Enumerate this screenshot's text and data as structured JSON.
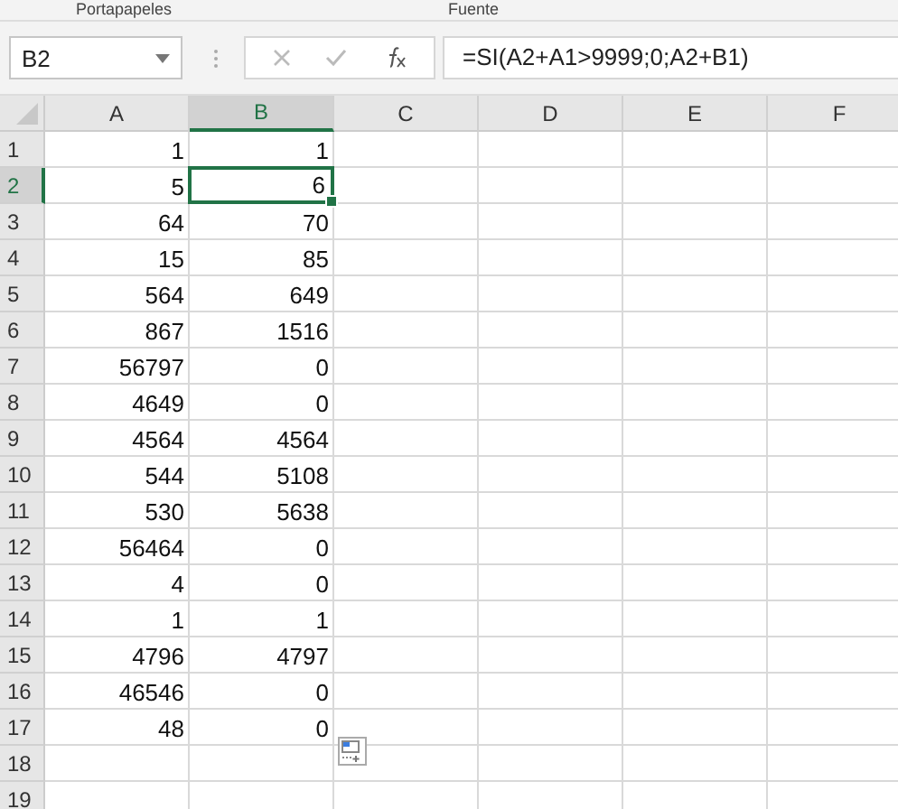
{
  "ribbon_groups": [
    "Portapapeles",
    "Fuente"
  ],
  "name_box": {
    "value": "B2"
  },
  "formula_bar": {
    "value": "=SI(A2+A1>9999;0;A2+B1)"
  },
  "columns": [
    {
      "label": "A",
      "selected": false
    },
    {
      "label": "B",
      "selected": true
    },
    {
      "label": "C",
      "selected": false
    },
    {
      "label": "D",
      "selected": false
    },
    {
      "label": "E",
      "selected": false
    },
    {
      "label": "F",
      "selected": false
    }
  ],
  "rows": [
    {
      "number": "1",
      "selected": false,
      "cells": [
        "1",
        "1"
      ]
    },
    {
      "number": "2",
      "selected": true,
      "cells": [
        "5",
        "6"
      ]
    },
    {
      "number": "3",
      "selected": false,
      "cells": [
        "64",
        "70"
      ]
    },
    {
      "number": "4",
      "selected": false,
      "cells": [
        "15",
        "85"
      ]
    },
    {
      "number": "5",
      "selected": false,
      "cells": [
        "564",
        "649"
      ]
    },
    {
      "number": "6",
      "selected": false,
      "cells": [
        "867",
        "1516"
      ]
    },
    {
      "number": "7",
      "selected": false,
      "cells": [
        "56797",
        "0"
      ]
    },
    {
      "number": "8",
      "selected": false,
      "cells": [
        "4649",
        "0"
      ]
    },
    {
      "number": "9",
      "selected": false,
      "cells": [
        "4564",
        "4564"
      ]
    },
    {
      "number": "10",
      "selected": false,
      "cells": [
        "544",
        "5108"
      ]
    },
    {
      "number": "11",
      "selected": false,
      "cells": [
        "530",
        "5638"
      ]
    },
    {
      "number": "12",
      "selected": false,
      "cells": [
        "56464",
        "0"
      ]
    },
    {
      "number": "13",
      "selected": false,
      "cells": [
        "4",
        "0"
      ]
    },
    {
      "number": "14",
      "selected": false,
      "cells": [
        "1",
        "1"
      ]
    },
    {
      "number": "15",
      "selected": false,
      "cells": [
        "4796",
        "4797"
      ]
    },
    {
      "number": "16",
      "selected": false,
      "cells": [
        "46546",
        "0"
      ]
    },
    {
      "number": "17",
      "selected": false,
      "cells": [
        "48",
        "0"
      ]
    },
    {
      "number": "18",
      "selected": false,
      "cells": []
    },
    {
      "number": "19",
      "selected": false,
      "cells": []
    }
  ]
}
